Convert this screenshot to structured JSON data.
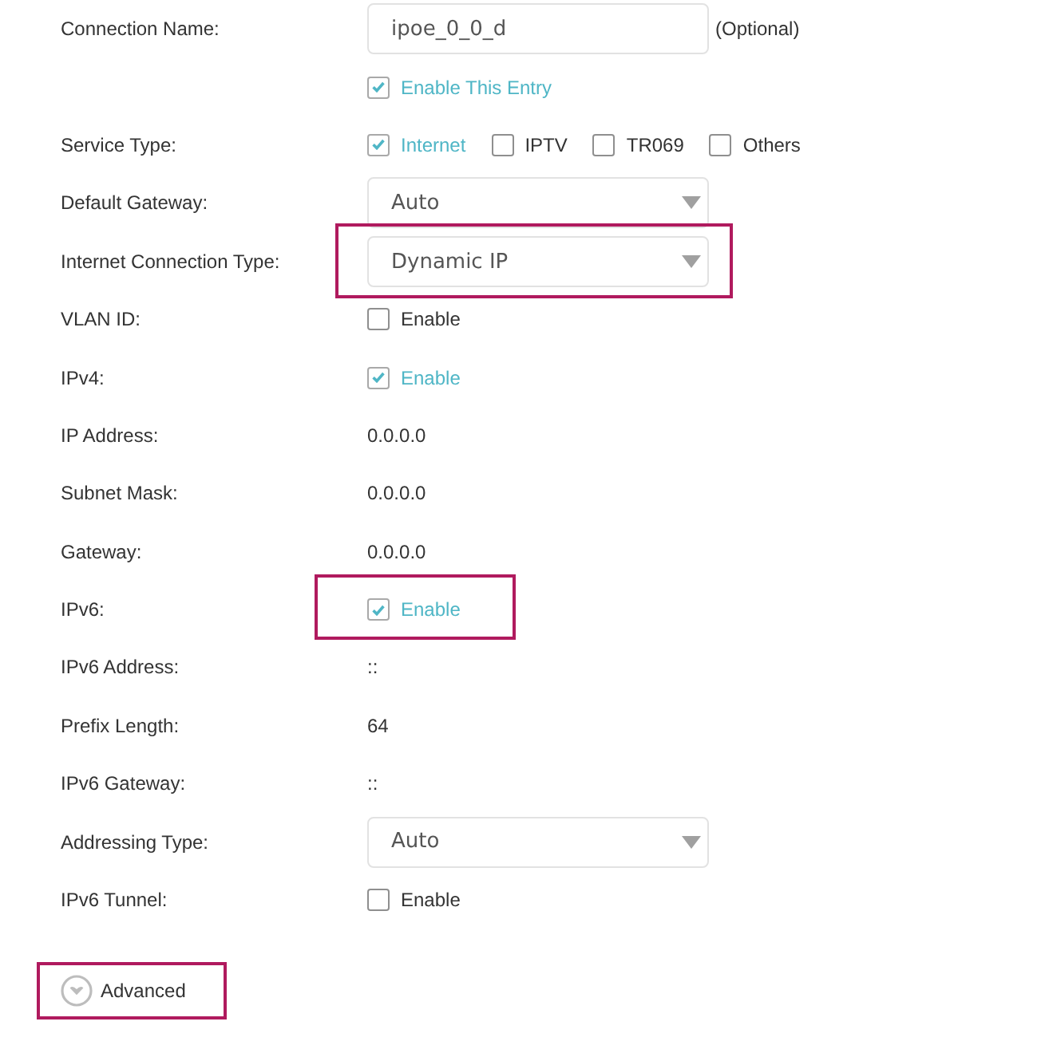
{
  "fields": [
    {
      "kind": "input",
      "label": "Connection Name:",
      "value": "ipoe_0_0_d",
      "hint": "(Optional)",
      "highlighted": false
    },
    {
      "kind": "checks",
      "options": [
        {
          "label": "Enable This Entry",
          "checked": true
        }
      ],
      "highlighted": false
    },
    {
      "kind": "checks",
      "label": "Service Type:",
      "options": [
        {
          "label": "Internet",
          "checked": true
        },
        {
          "label": "IPTV",
          "checked": false
        },
        {
          "label": "TR069",
          "checked": false
        },
        {
          "label": "Others",
          "checked": false
        }
      ],
      "highlighted": false
    },
    {
      "kind": "select",
      "label": "Default Gateway:",
      "value": "Auto",
      "highlighted": false
    },
    {
      "kind": "select",
      "label": "Internet Connection Type:",
      "value": "Dynamic IP",
      "highlighted": true
    },
    {
      "kind": "checks",
      "label": "VLAN ID:",
      "options": [
        {
          "label": "Enable",
          "checked": false
        }
      ],
      "highlighted": false
    },
    {
      "kind": "checks",
      "label": "IPv4:",
      "options": [
        {
          "label": "Enable",
          "checked": true
        }
      ],
      "highlighted": false
    },
    {
      "kind": "value",
      "label": "IP Address:",
      "value": "0.0.0.0",
      "highlighted": false
    },
    {
      "kind": "value",
      "label": "Subnet Mask:",
      "value": "0.0.0.0",
      "highlighted": false
    },
    {
      "kind": "value",
      "label": "Gateway:",
      "value": "0.0.0.0",
      "highlighted": false
    },
    {
      "kind": "checks",
      "label": "IPv6:",
      "options": [
        {
          "label": "Enable",
          "checked": true
        }
      ],
      "highlighted": true
    },
    {
      "kind": "value",
      "label": "IPv6 Address:",
      "value": "::",
      "highlighted": false
    },
    {
      "kind": "value",
      "label": "Prefix Length:",
      "value": "64",
      "highlighted": false
    },
    {
      "kind": "value",
      "label": "IPv6 Gateway:",
      "value": "::",
      "highlighted": false
    },
    {
      "kind": "select",
      "label": "Addressing Type:",
      "value": "Auto",
      "highlighted": false
    },
    {
      "kind": "checks",
      "label": "IPv6 Tunnel:",
      "options": [
        {
          "label": "Enable",
          "checked": false
        }
      ],
      "highlighted": false
    }
  ],
  "advanced": {
    "label": "Advanced",
    "highlighted": true
  }
}
